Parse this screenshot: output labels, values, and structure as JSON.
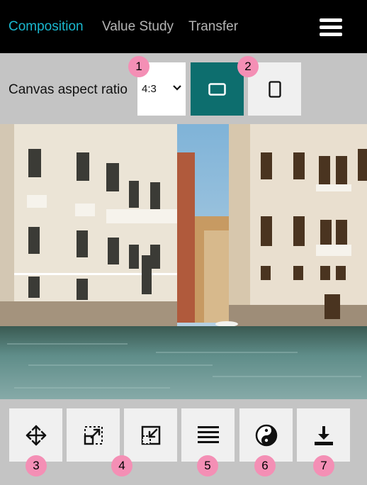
{
  "nav": {
    "tabs": [
      {
        "label": "Composition",
        "active": true
      },
      {
        "label": "Value Study",
        "active": false
      },
      {
        "label": "Transfer",
        "active": false
      }
    ],
    "menu_icon": "hamburger-menu-icon"
  },
  "controls": {
    "aspect_label": "Canvas aspect ratio",
    "aspect_value": "4:3",
    "landscape_icon": "landscape-rectangle-icon",
    "portrait_icon": "portrait-rectangle-icon"
  },
  "photo": {
    "subject": "Venice canal with old palazzo buildings and green water"
  },
  "tools": [
    {
      "icon": "move-arrows-icon"
    },
    {
      "icon": "expand-frame-icon"
    },
    {
      "icon": "shrink-frame-icon"
    },
    {
      "icon": "horizontal-lines-icon"
    },
    {
      "icon": "yin-yang-icon"
    },
    {
      "icon": "download-icon"
    }
  ],
  "badges": [
    "1",
    "2",
    "3",
    "4",
    "5",
    "6",
    "7"
  ],
  "colors": {
    "accent": "#1ab8cf",
    "teal_button": "#0d6e6e",
    "badge": "#f48fb5",
    "topbar": "#000000"
  }
}
